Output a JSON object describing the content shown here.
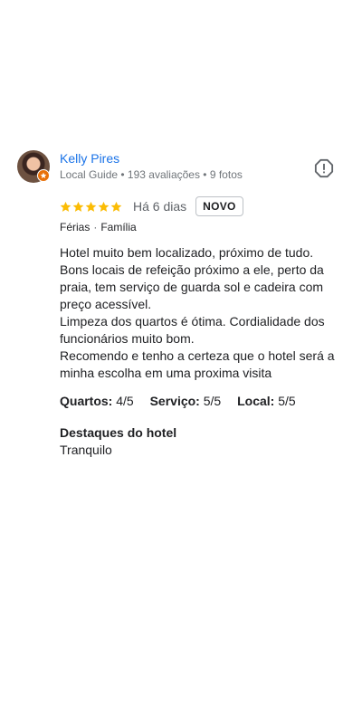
{
  "review": {
    "author": "Kelly Pires",
    "meta": "Local Guide • 193 avaliações • 9 fotos",
    "rating": 5,
    "date": "Há 6 dias",
    "badge": "NOVO",
    "tags": [
      "Férias",
      "Família"
    ],
    "text_lines": [
      "Hotel muito bem localizado, próximo de tudo.",
      "Bons locais de refeição próximo a ele, perto da praia, tem serviço de guarda sol e cadeira com preço acessível.",
      "Limpeza dos quartos é ótima. Cordialidade dos funcionários muito bom.",
      "Recomendo e tenho a certeza que o hotel será a minha escolha em uma proxima visita"
    ],
    "subratings": [
      {
        "label": "Quartos:",
        "value": "4/5"
      },
      {
        "label": "Serviço:",
        "value": "5/5"
      },
      {
        "label": "Local:",
        "value": "5/5"
      }
    ],
    "highlights_title": "Destaques do hotel",
    "highlights_value": "Tranquilo"
  },
  "icons": {
    "avatar": "profile-photo",
    "guide_badge": "star-badge-icon",
    "report": "report-flag-icon",
    "star": "star-icon"
  },
  "colors": {
    "author": "#1a73e8",
    "star": "#fbbc04",
    "guide_badge": "#e8710a"
  }
}
